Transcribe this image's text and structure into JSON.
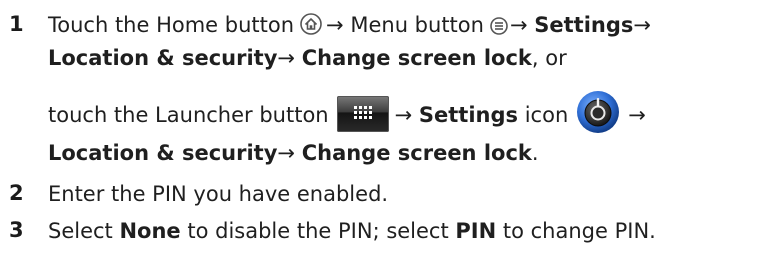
{
  "steps": [
    {
      "number": "1",
      "line1": {
        "t1": "Touch the Home button",
        "arrow1": "→",
        "t2": "Menu button",
        "arrow2": "→",
        "settings": "Settings",
        "arrow3": "→"
      },
      "line2": {
        "location": "Location & security",
        "arrow": "→",
        "change": "Change screen lock",
        "rest": ", or"
      },
      "line3": {
        "t1": "touch the Launcher button",
        "arrow1": "→",
        "settings": "Settings",
        "t2": "icon",
        "arrow2": "→"
      },
      "line4": {
        "location": "Location & security",
        "arrow": "→",
        "change": "Change screen lock",
        "end": "."
      }
    },
    {
      "number": "2",
      "text": "Enter the PIN you have enabled."
    },
    {
      "number": "3",
      "t1": "Select",
      "none": "None",
      "t2": "to disable the PIN; select",
      "pin": "PIN",
      "t3": "to change PIN."
    }
  ],
  "icons": {
    "home": "home-icon",
    "menu": "menu-icon",
    "launcher": "launcher-grid-icon",
    "settings": "settings-knob-icon"
  },
  "colors": {
    "text": "#1f1f1f",
    "icon_gray": "#555555",
    "settings_blue": "#2f6fd6"
  }
}
